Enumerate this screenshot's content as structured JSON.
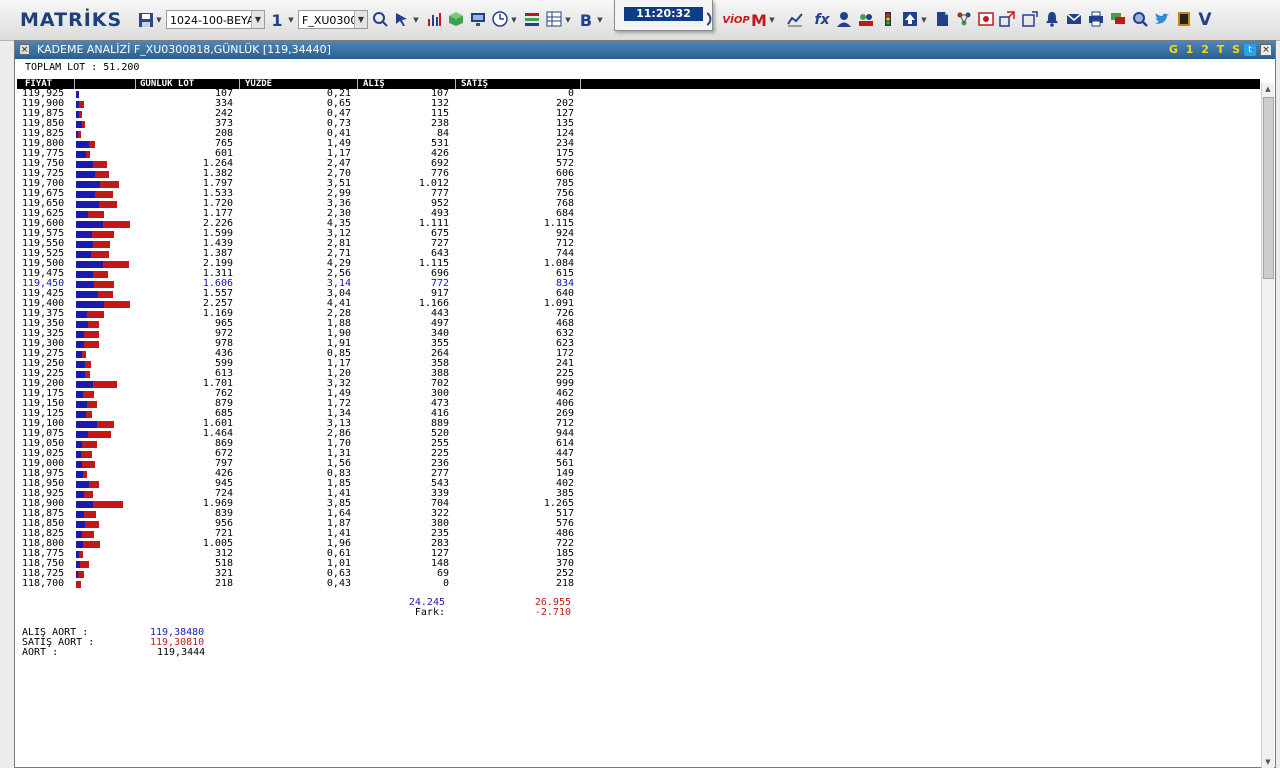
{
  "app": {
    "logo": "MATRİKS",
    "clock": "11:20:32"
  },
  "toolbar": {
    "layout_combo": "1024-100-BEYA",
    "number_label": "1",
    "symbol_combo": "F_XU0300",
    "bold_label": "B",
    "viop_label": "VİOP",
    "fx_label": "fx",
    "v_label": "V"
  },
  "window": {
    "title": "KADEME ANALİZİ F_XU0300818,GÜNLÜK [119,34440]",
    "badge": "G 1 2 T S",
    "total_label": "TOPLAM LOT : 51.200"
  },
  "table": {
    "columns": [
      "FİYAT",
      "GÜNLÜK LOT",
      "YÜZDE",
      "ALIŞ",
      "SATIŞ"
    ],
    "rows": [
      {
        "price": "119,925",
        "lot": "107",
        "pct": "0,21",
        "bid": "107",
        "ask": "0",
        "b": 107,
        "s": 0
      },
      {
        "price": "119,900",
        "lot": "334",
        "pct": "0,65",
        "bid": "132",
        "ask": "202",
        "b": 132,
        "s": 202
      },
      {
        "price": "119,875",
        "lot": "242",
        "pct": "0,47",
        "bid": "115",
        "ask": "127",
        "b": 115,
        "s": 127
      },
      {
        "price": "119,850",
        "lot": "373",
        "pct": "0,73",
        "bid": "238",
        "ask": "135",
        "b": 238,
        "s": 135
      },
      {
        "price": "119,825",
        "lot": "208",
        "pct": "0,41",
        "bid": "84",
        "ask": "124",
        "b": 84,
        "s": 124
      },
      {
        "price": "119,800",
        "lot": "765",
        "pct": "1,49",
        "bid": "531",
        "ask": "234",
        "b": 531,
        "s": 234
      },
      {
        "price": "119,775",
        "lot": "601",
        "pct": "1,17",
        "bid": "426",
        "ask": "175",
        "b": 426,
        "s": 175
      },
      {
        "price": "119,750",
        "lot": "1.264",
        "pct": "2,47",
        "bid": "692",
        "ask": "572",
        "b": 692,
        "s": 572
      },
      {
        "price": "119,725",
        "lot": "1.382",
        "pct": "2,70",
        "bid": "776",
        "ask": "606",
        "b": 776,
        "s": 606
      },
      {
        "price": "119,700",
        "lot": "1.797",
        "pct": "3,51",
        "bid": "1.012",
        "ask": "785",
        "b": 1012,
        "s": 785
      },
      {
        "price": "119,675",
        "lot": "1.533",
        "pct": "2,99",
        "bid": "777",
        "ask": "756",
        "b": 777,
        "s": 756
      },
      {
        "price": "119,650",
        "lot": "1.720",
        "pct": "3,36",
        "bid": "952",
        "ask": "768",
        "b": 952,
        "s": 768
      },
      {
        "price": "119,625",
        "lot": "1.177",
        "pct": "2,30",
        "bid": "493",
        "ask": "684",
        "b": 493,
        "s": 684
      },
      {
        "price": "119,600",
        "lot": "2.226",
        "pct": "4,35",
        "bid": "1.111",
        "ask": "1.115",
        "b": 1111,
        "s": 1115
      },
      {
        "price": "119,575",
        "lot": "1.599",
        "pct": "3,12",
        "bid": "675",
        "ask": "924",
        "b": 675,
        "s": 924
      },
      {
        "price": "119,550",
        "lot": "1.439",
        "pct": "2,81",
        "bid": "727",
        "ask": "712",
        "b": 727,
        "s": 712
      },
      {
        "price": "119,525",
        "lot": "1.387",
        "pct": "2,71",
        "bid": "643",
        "ask": "744",
        "b": 643,
        "s": 744
      },
      {
        "price": "119,500",
        "lot": "2.199",
        "pct": "4,29",
        "bid": "1.115",
        "ask": "1.084",
        "b": 1115,
        "s": 1084
      },
      {
        "price": "119,475",
        "lot": "1.311",
        "pct": "2,56",
        "bid": "696",
        "ask": "615",
        "b": 696,
        "s": 615
      },
      {
        "price": "119,450",
        "lot": "1.606",
        "pct": "3,14",
        "bid": "772",
        "ask": "834",
        "b": 772,
        "s": 834,
        "hl": true
      },
      {
        "price": "119,425",
        "lot": "1.557",
        "pct": "3,04",
        "bid": "917",
        "ask": "640",
        "b": 917,
        "s": 640
      },
      {
        "price": "119,400",
        "lot": "2.257",
        "pct": "4,41",
        "bid": "1.166",
        "ask": "1.091",
        "b": 1166,
        "s": 1091
      },
      {
        "price": "119,375",
        "lot": "1.169",
        "pct": "2,28",
        "bid": "443",
        "ask": "726",
        "b": 443,
        "s": 726
      },
      {
        "price": "119,350",
        "lot": "965",
        "pct": "1,88",
        "bid": "497",
        "ask": "468",
        "b": 497,
        "s": 468
      },
      {
        "price": "119,325",
        "lot": "972",
        "pct": "1,90",
        "bid": "340",
        "ask": "632",
        "b": 340,
        "s": 632
      },
      {
        "price": "119,300",
        "lot": "978",
        "pct": "1,91",
        "bid": "355",
        "ask": "623",
        "b": 355,
        "s": 623
      },
      {
        "price": "119,275",
        "lot": "436",
        "pct": "0,85",
        "bid": "264",
        "ask": "172",
        "b": 264,
        "s": 172
      },
      {
        "price": "119,250",
        "lot": "599",
        "pct": "1,17",
        "bid": "358",
        "ask": "241",
        "b": 358,
        "s": 241
      },
      {
        "price": "119,225",
        "lot": "613",
        "pct": "1,20",
        "bid": "388",
        "ask": "225",
        "b": 388,
        "s": 225
      },
      {
        "price": "119,200",
        "lot": "1.701",
        "pct": "3,32",
        "bid": "702",
        "ask": "999",
        "b": 702,
        "s": 999
      },
      {
        "price": "119,175",
        "lot": "762",
        "pct": "1,49",
        "bid": "300",
        "ask": "462",
        "b": 300,
        "s": 462
      },
      {
        "price": "119,150",
        "lot": "879",
        "pct": "1,72",
        "bid": "473",
        "ask": "406",
        "b": 473,
        "s": 406
      },
      {
        "price": "119,125",
        "lot": "685",
        "pct": "1,34",
        "bid": "416",
        "ask": "269",
        "b": 416,
        "s": 269
      },
      {
        "price": "119,100",
        "lot": "1.601",
        "pct": "3,13",
        "bid": "889",
        "ask": "712",
        "b": 889,
        "s": 712
      },
      {
        "price": "119,075",
        "lot": "1.464",
        "pct": "2,86",
        "bid": "520",
        "ask": "944",
        "b": 520,
        "s": 944
      },
      {
        "price": "119,050",
        "lot": "869",
        "pct": "1,70",
        "bid": "255",
        "ask": "614",
        "b": 255,
        "s": 614
      },
      {
        "price": "119,025",
        "lot": "672",
        "pct": "1,31",
        "bid": "225",
        "ask": "447",
        "b": 225,
        "s": 447
      },
      {
        "price": "119,000",
        "lot": "797",
        "pct": "1,56",
        "bid": "236",
        "ask": "561",
        "b": 236,
        "s": 561
      },
      {
        "price": "118,975",
        "lot": "426",
        "pct": "0,83",
        "bid": "277",
        "ask": "149",
        "b": 277,
        "s": 149
      },
      {
        "price": "118,950",
        "lot": "945",
        "pct": "1,85",
        "bid": "543",
        "ask": "402",
        "b": 543,
        "s": 402
      },
      {
        "price": "118,925",
        "lot": "724",
        "pct": "1,41",
        "bid": "339",
        "ask": "385",
        "b": 339,
        "s": 385
      },
      {
        "price": "118,900",
        "lot": "1.969",
        "pct": "3,85",
        "bid": "704",
        "ask": "1.265",
        "b": 704,
        "s": 1265
      },
      {
        "price": "118,875",
        "lot": "839",
        "pct": "1,64",
        "bid": "322",
        "ask": "517",
        "b": 322,
        "s": 517
      },
      {
        "price": "118,850",
        "lot": "956",
        "pct": "1,87",
        "bid": "380",
        "ask": "576",
        "b": 380,
        "s": 576
      },
      {
        "price": "118,825",
        "lot": "721",
        "pct": "1,41",
        "bid": "235",
        "ask": "486",
        "b": 235,
        "s": 486
      },
      {
        "price": "118,800",
        "lot": "1.005",
        "pct": "1,96",
        "bid": "283",
        "ask": "722",
        "b": 283,
        "s": 722
      },
      {
        "price": "118,775",
        "lot": "312",
        "pct": "0,61",
        "bid": "127",
        "ask": "185",
        "b": 127,
        "s": 185
      },
      {
        "price": "118,750",
        "lot": "518",
        "pct": "1,01",
        "bid": "148",
        "ask": "370",
        "b": 148,
        "s": 370
      },
      {
        "price": "118,725",
        "lot": "321",
        "pct": "0,63",
        "bid": "69",
        "ask": "252",
        "b": 69,
        "s": 252
      },
      {
        "price": "118,700",
        "lot": "218",
        "pct": "0,43",
        "bid": "0",
        "ask": "218",
        "b": 0,
        "s": 218
      }
    ],
    "total_bid": "24.245",
    "total_ask": "26.955",
    "diff_label": "Fark:",
    "diff_value": "-2.710"
  },
  "averages": {
    "bid_label": "ALIŞ AORT :",
    "bid_value": "119,38480",
    "ask_label": "SATIŞ AORT :",
    "ask_value": "119,30810",
    "avg_label": "AORT :",
    "avg_value": "119,3444"
  },
  "colors": {
    "bid": "#1a1ab0",
    "ask": "#c41818",
    "highlight": "#1010c0"
  },
  "icons": [
    "save-icon",
    "zoom-icon",
    "cursor-icon",
    "chart-icon",
    "cube-icon",
    "monitor-icon",
    "clock-icon",
    "list-icon",
    "grid-icon",
    "m-icon",
    "line-chart-icon",
    "user-icon",
    "people-icon",
    "traffic-light-icon",
    "upload-icon",
    "document-icon",
    "network-icon",
    "news-icon",
    "resize-icon",
    "bell-icon",
    "mail-icon",
    "print-icon",
    "chat-icon",
    "search-icon",
    "twitter-icon",
    "book-icon"
  ]
}
